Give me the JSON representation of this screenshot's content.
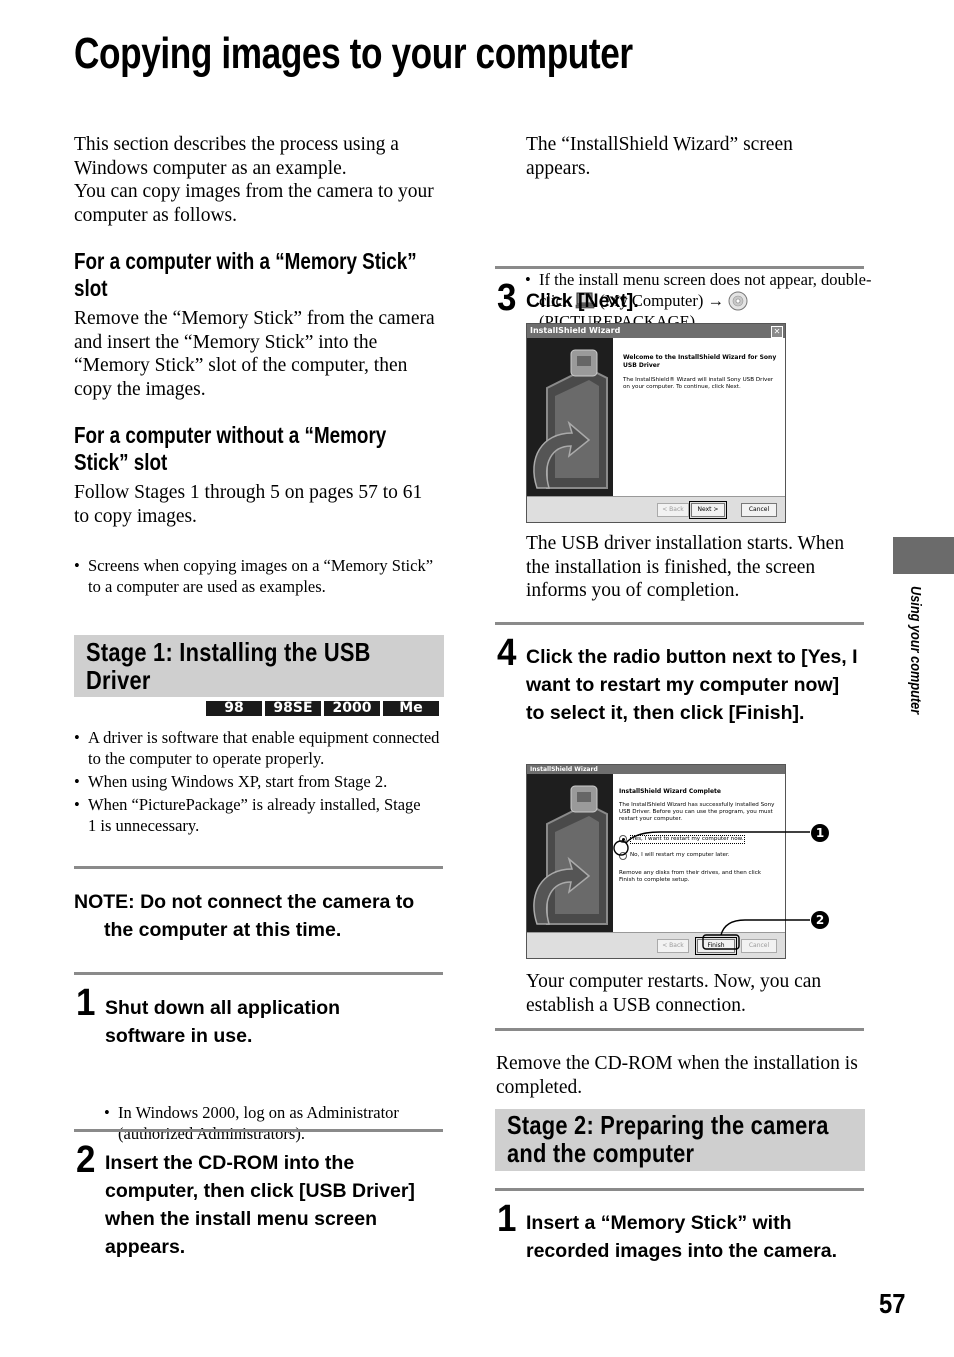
{
  "page": {
    "title": "Copying images to your computer",
    "side_tab_label": "Using your computer",
    "page_number": "57"
  },
  "left": {
    "intro": [
      "This section describes the process using a Windows computer as an example.",
      "You can copy images from the camera to your computer as follows."
    ],
    "with_slot": {
      "heading": "For a computer with a “Memory Stick” slot",
      "body": "Remove the “Memory Stick” from the camera and insert the “Memory Stick” into the “Memory Stick” slot of the computer, then copy the images."
    },
    "without_slot": {
      "heading": "For a computer without a “Memory Stick” slot",
      "body": "Follow Stages 1 through 5 on pages 57 to 61 to copy images."
    },
    "note_bullet": "Screens when copying images on a “Memory Stick” to a computer are used as examples.",
    "stage1": {
      "title": "Stage 1: Installing the USB Driver",
      "os_badges": [
        "98",
        "98SE",
        "2000",
        "Me"
      ],
      "bullets": [
        "A driver is software that enable equipment connected to the computer to operate properly.",
        "When using Windows XP, start from Stage 2.",
        "When “PicturePackage” is already installed, Stage 1 is unnecessary."
      ]
    },
    "warning": {
      "line1": "NOTE: Do not connect the camera to",
      "line2": "the computer at this time."
    },
    "step1": {
      "num": "1",
      "text": "Shut down all application software in use.",
      "bullet": "In Windows 2000, log on as Administrator (authorized Administrators)."
    },
    "step2": {
      "num": "2",
      "text": "Insert the CD-ROM into the computer, then click [USB Driver] when the install menu screen appears."
    }
  },
  "right": {
    "wizard_appears": "The “InstallShield Wizard” screen appears.",
    "wizard_tip": {
      "part1": "If the install menu screen does not appear, double-click",
      "my_computer": "(My Computer)",
      "arrow": "→",
      "part2": "(PICTUREPACKAGE).",
      "icons": [
        "my-computer-icon",
        "cd-rom-icon"
      ]
    },
    "step3": {
      "num": "3",
      "text": "Click [Next].",
      "dialog": {
        "title": "InstallShield Wizard",
        "heading": "Welcome to the InstallShield Wizard for Sony USB Driver",
        "body": "The InstallShield® Wizard will install Sony USB Driver on your computer. To continue, click Next.",
        "buttons": {
          "back": "< Back",
          "next": "Next >",
          "cancel": "Cancel"
        }
      },
      "after": "The USB driver installation starts. When the installation is finished, the screen informs you of completion."
    },
    "step4": {
      "num": "4",
      "text": "Click the radio button next to [Yes, I want to restart my computer now] to select it, then click [Finish].",
      "dialog": {
        "title": "InstallShield Wizard",
        "heading": "InstallShield Wizard Complete",
        "body": "The InstallShield Wizard has successfully installed Sony USB Driver. Before you can use the program, you must restart your computer.",
        "radio_yes": "Yes, I want to restart my computer now.",
        "radio_no": "No, I will restart my computer later.",
        "remove_note": "Remove any disks from their drives, and then click Finish to complete setup.",
        "buttons": {
          "back": "< Back",
          "finish": "Finish",
          "cancel": "Cancel"
        },
        "callouts": [
          "1",
          "2"
        ]
      },
      "after": "Your computer restarts. Now, you can establish a USB connection."
    },
    "remove_cd": "Remove the CD-ROM when the installation is completed.",
    "stage2": {
      "title": "Stage 2: Preparing the camera and the computer",
      "step1": {
        "num": "1",
        "text": "Insert a “Memory Stick” with recorded images into the camera."
      }
    }
  }
}
